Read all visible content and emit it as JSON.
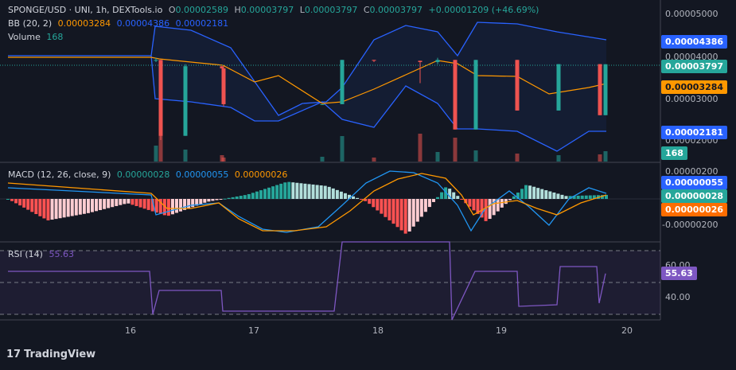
{
  "chart_data": {
    "type": "candlestick",
    "symbol_line": "SPONGE/USD · UNI, 1h, DEXTools.io",
    "ohlc": {
      "o_label": "O",
      "o": "0.00002589",
      "h_label": "H",
      "h": "0.00003797",
      "l_label": "L",
      "l": "0.00003797",
      "c_label": "C",
      "c": "0.00003797",
      "change": "+0.00001209 (+46.69%)"
    },
    "bb": {
      "label": "BB (20, 2)",
      "basis": "0.00003284",
      "upper": "0.00004386",
      "lower": "0.00002181"
    },
    "volume": {
      "label": "Volume",
      "value": "168"
    },
    "macd": {
      "label": "MACD (12, 26, close, 9)",
      "hist": "0.00000028",
      "macd": "0.00000055",
      "signal": "0.00000026"
    },
    "rsi": {
      "label": "RSI (14)",
      "value": "55.63"
    },
    "price_axis": {
      "ticks": [
        "0.00005000",
        "0.00004000",
        "0.00003000",
        "0.00002000"
      ]
    },
    "macd_axis": {
      "ticks": [
        "0.00000200",
        "-0.00000200"
      ]
    },
    "rsi_axis": {
      "ticks": [
        "60.00",
        "40.00"
      ]
    },
    "x_axis": {
      "ticks": [
        "16",
        "17",
        "18",
        "19",
        "20"
      ]
    },
    "candles": [
      [
        3.9e-05,
        3.95e-05,
        3.85e-05,
        3.9e-05
      ],
      [
        3.9e-05,
        3.9e-05,
        2e-05,
        2.1e-05
      ],
      [
        2.1e-05,
        3.8e-05,
        2.1e-05,
        3.75e-05
      ],
      [
        3.75e-05,
        3.75e-05,
        3.7e-05,
        3.7e-05
      ],
      [
        3.7e-05,
        3.7e-05,
        2.8e-05,
        2.85e-05
      ],
      [
        2.85e-05,
        2.85e-05,
        2.85e-05,
        2.85e-05
      ],
      [
        2.85e-05,
        3.9e-05,
        2.85e-05,
        3.9e-05
      ],
      [
        3.9e-05,
        3.9e-05,
        3.85e-05,
        3.88e-05
      ],
      [
        3.88e-05,
        3.88e-05,
        3.35e-05,
        3.85e-05
      ],
      [
        3.85e-05,
        3.95e-05,
        3.8e-05,
        3.9e-05
      ],
      [
        3.9e-05,
        3.9e-05,
        2.25e-05,
        2.25e-05
      ],
      [
        2.25e-05,
        3.9e-05,
        2.25e-05,
        3.9e-05
      ],
      [
        3.9e-05,
        3.9e-05,
        2.7e-05,
        2.7e-05
      ],
      [
        2.7e-05,
        3.8e-05,
        2.7e-05,
        3.8e-05
      ],
      [
        3.8e-05,
        3.8e-05,
        2.589e-05,
        2.589e-05
      ],
      [
        2.589e-05,
        3.797e-05,
        2.589e-05,
        3.797e-05
      ]
    ],
    "candle_x": [
      196,
      202,
      233,
      279,
      281,
      405,
      430,
      470,
      528,
      550,
      572,
      598,
      650,
      702,
      754,
      761
    ],
    "volumes": [
      20,
      60,
      15,
      8,
      5,
      6,
      32,
      5,
      35,
      12,
      30,
      14,
      10,
      8,
      9,
      13
    ],
    "macd_hist": [
      0,
      -1.5e-06,
      -1e-06,
      -3e-07,
      -1.2e-06,
      -2e-07,
      3e-07,
      1.2e-06,
      9e-07,
      -2e-07,
      -2.5e-06,
      9e-07,
      -1.6e-06,
      1e-06,
      2e-07,
      2.8e-07
    ],
    "rsi_series": [
      [
        10,
        57
      ],
      [
        188,
        57
      ],
      [
        192,
        30
      ],
      [
        200,
        45
      ],
      [
        278,
        45
      ],
      [
        280,
        32
      ],
      [
        420,
        32
      ],
      [
        430,
        100
      ],
      [
        520,
        100
      ],
      [
        530,
        78
      ],
      [
        565,
        78
      ],
      [
        568,
        20
      ],
      [
        597,
        57
      ],
      [
        650,
        57
      ],
      [
        652,
        35
      ],
      [
        700,
        36
      ],
      [
        704,
        60
      ],
      [
        750,
        60
      ],
      [
        753,
        37
      ],
      [
        761,
        55.63
      ]
    ]
  },
  "colors": {
    "up": "#26a69a",
    "down": "#ef5350",
    "bb_line": "#2962ff",
    "basis": "#ff9800",
    "macd_line": "#2196f3",
    "signal_line": "#ff9800",
    "rsi_line": "#7e57c2"
  },
  "branding": {
    "name": "TradingView",
    "logo": "17"
  }
}
